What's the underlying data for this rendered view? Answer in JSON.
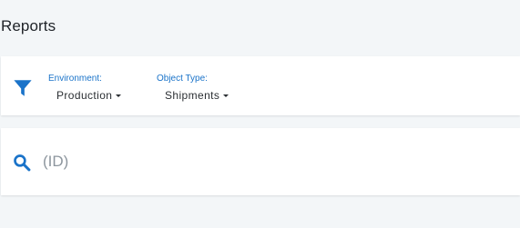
{
  "page": {
    "title": "Reports"
  },
  "filters": {
    "environment": {
      "label": "Environment:",
      "value": "Production"
    },
    "object_type": {
      "label": "Object Type:",
      "value": "Shipments"
    }
  },
  "search": {
    "placeholder": "(ID)",
    "value": ""
  },
  "icons": {
    "filter": "filter-icon",
    "search": "search-icon"
  },
  "colors": {
    "accent": "#1a73c9",
    "background": "#f3f6f8",
    "card": "#ffffff"
  }
}
